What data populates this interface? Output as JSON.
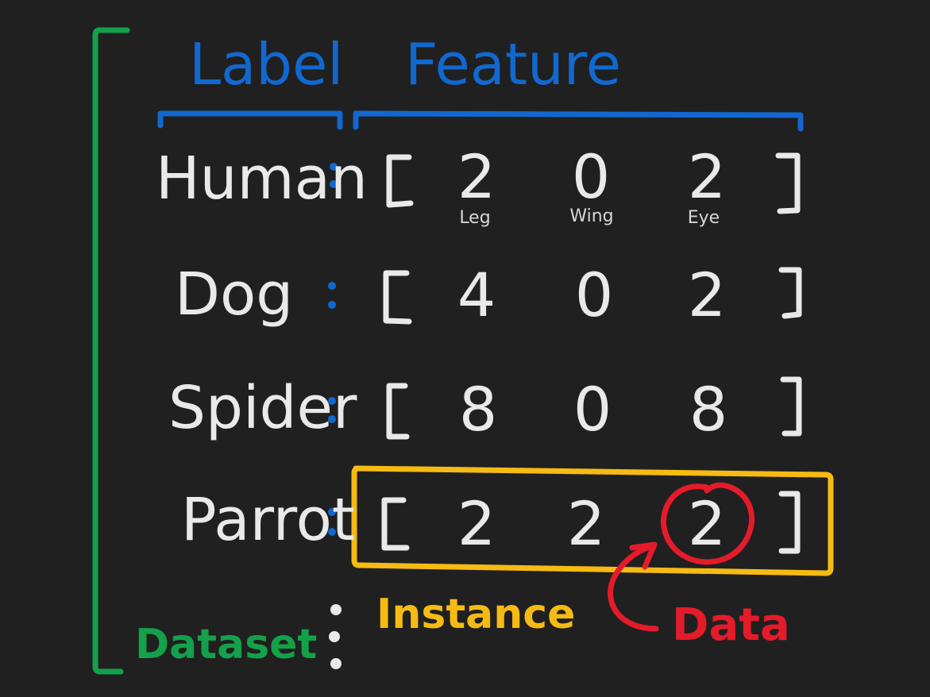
{
  "headers": {
    "label": "Label",
    "feature": "Feature"
  },
  "feature_names": [
    "Leg",
    "Wing",
    "Eye"
  ],
  "rows": [
    {
      "label": "Human",
      "values": [
        "2",
        "0",
        "2"
      ]
    },
    {
      "label": "Dog",
      "values": [
        "4",
        "0",
        "2"
      ]
    },
    {
      "label": "Spider",
      "values": [
        "8",
        "0",
        "8"
      ]
    },
    {
      "label": "Parrot",
      "values": [
        "2",
        "2",
        "2"
      ]
    }
  ],
  "annotations": {
    "dataset": "Dataset",
    "instance": "Instance",
    "data": "Data"
  },
  "colors": {
    "background": "#202020",
    "text": "#e9e9e9",
    "feature_blue": "#1168cf",
    "dataset_green": "#13a14a",
    "instance_yellow": "#f6bb13",
    "data_red": "#e41b2a"
  }
}
